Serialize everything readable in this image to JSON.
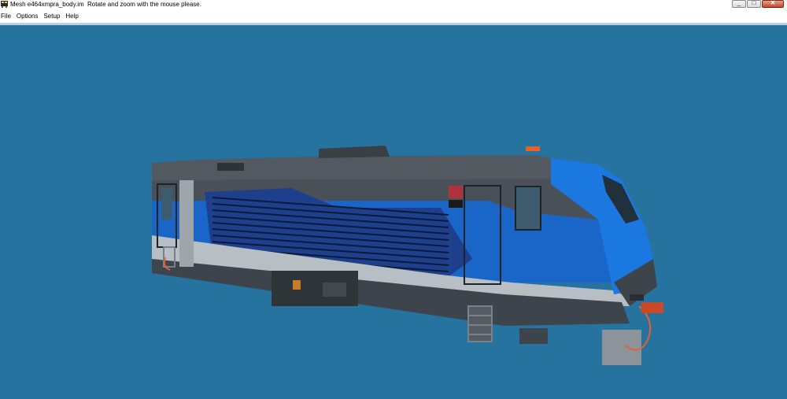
{
  "window": {
    "title": "Mesh e464xmpra_body.im",
    "hint": "Rotate and zoom with the mouse please.",
    "app_icon": "train-app-icon",
    "buttons": {
      "minimize": "minimize-icon",
      "maximize": "maximize-icon",
      "close": "close-icon"
    }
  },
  "menu": [
    "File",
    "Options",
    "Setup",
    "Help"
  ],
  "viewport": {
    "background": "#2673a0",
    "model": "locomotive-3d-model",
    "colors": {
      "body_gray": "#4a5058",
      "stripe_blue": "#1a66c8",
      "dark_blue": "#1e3f8c",
      "light_gray": "#b8bfc4",
      "accent_orange": "#e8602c"
    }
  }
}
